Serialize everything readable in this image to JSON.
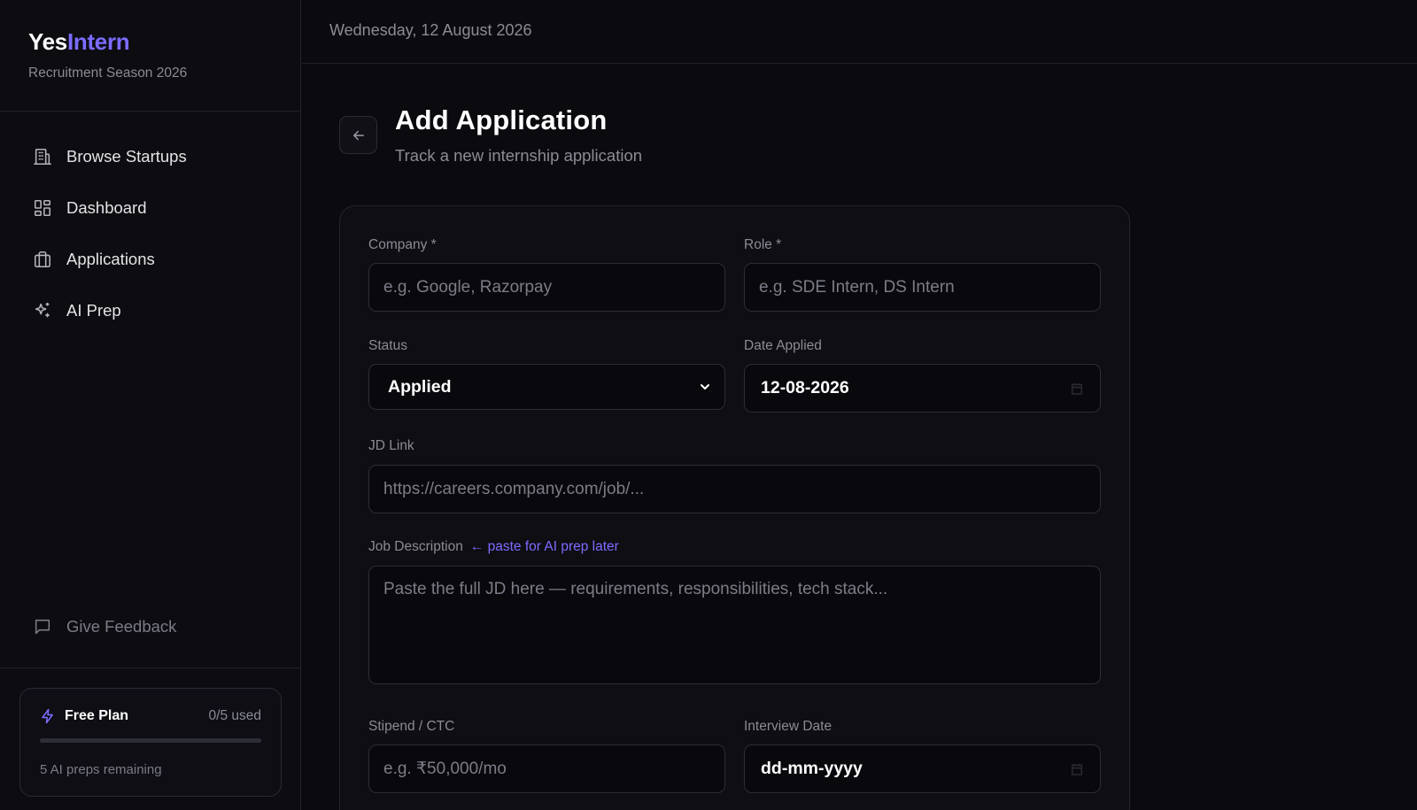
{
  "brand": {
    "name_part1": "Yes",
    "name_part2": "Intern",
    "subtitle": "Recruitment Season 2026"
  },
  "sidebar": {
    "items": [
      {
        "label": "Browse Startups",
        "icon": "building-icon"
      },
      {
        "label": "Dashboard",
        "icon": "grid-icon"
      },
      {
        "label": "Applications",
        "icon": "briefcase-icon"
      },
      {
        "label": "AI Prep",
        "icon": "sparkles-icon"
      }
    ],
    "feedback_label": "Give Feedback"
  },
  "plan": {
    "title": "Free Plan",
    "used": "0/5 used",
    "used_fraction": 0,
    "remaining": "5 AI preps remaining"
  },
  "header": {
    "date": "Wednesday, 12 August 2026"
  },
  "page": {
    "title": "Add Application",
    "subtitle": "Track a new internship application"
  },
  "form": {
    "company": {
      "label": "Company *",
      "placeholder": "e.g. Google, Razorpay"
    },
    "role": {
      "label": "Role *",
      "placeholder": "e.g. SDE Intern, DS Intern"
    },
    "status": {
      "label": "Status",
      "value": "Applied"
    },
    "date_applied": {
      "label": "Date Applied",
      "value": "12-08-2026"
    },
    "jd_link": {
      "label": "JD Link",
      "placeholder": "https://careers.company.com/job/..."
    },
    "job_description": {
      "label": "Job Description",
      "hint": "← paste for AI prep later",
      "placeholder": "Paste the full JD here — requirements, responsibilities, tech stack..."
    },
    "stipend": {
      "label": "Stipend / CTC",
      "placeholder": "e.g. ₹50,000/mo"
    },
    "interview_date": {
      "label": "Interview Date",
      "value": "dd-mm-yyyy"
    }
  },
  "colors": {
    "accent": "#7c6cff",
    "background": "#0b0b0f",
    "card": "#0e0e13"
  }
}
